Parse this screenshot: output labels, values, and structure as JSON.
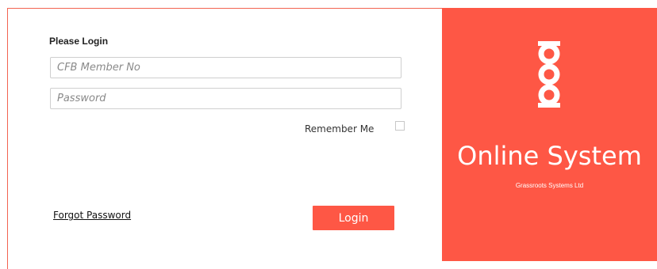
{
  "login": {
    "title": "Please Login",
    "member_placeholder": "CFB Member No",
    "password_placeholder": "Password",
    "remember_label": "Remember Me",
    "forgot_label": "Forgot Password",
    "login_label": "Login"
  },
  "brand": {
    "title": "Online System",
    "subtitle": "Grassroots Systems Ltd",
    "logo_icon": "chain-link-logo-icon",
    "color": "#fe5745"
  }
}
